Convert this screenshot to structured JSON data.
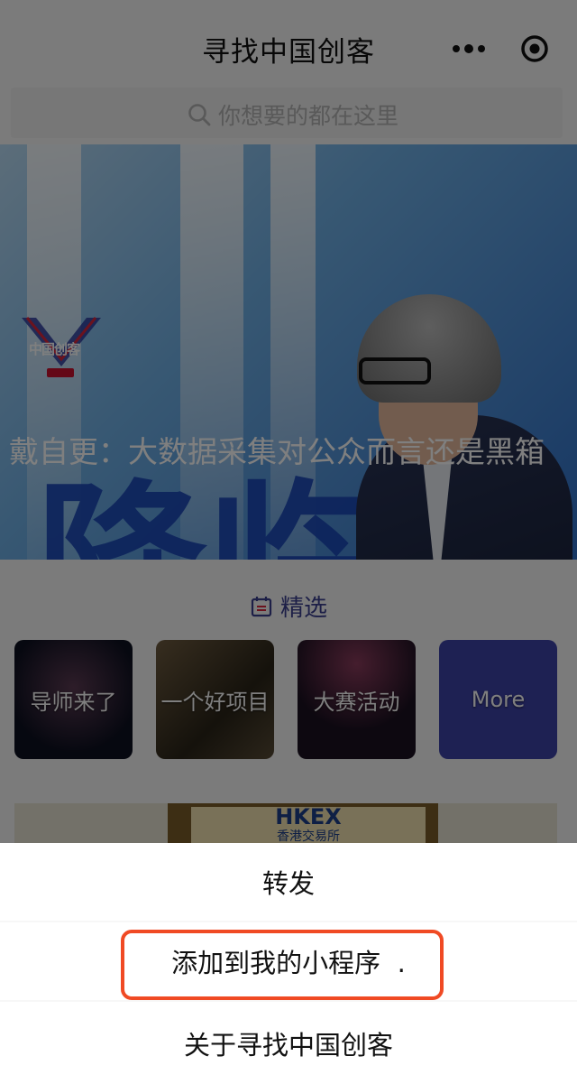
{
  "header": {
    "title": "寻找中国创客",
    "more_icon": "more-dots-icon",
    "close_icon": "target-close-icon"
  },
  "search": {
    "placeholder": "你想要的都在这里",
    "icon": "search-icon"
  },
  "banner": {
    "caption": "戴自更：大数据采集对公众而言还是黑箱",
    "background_text": "降临",
    "logo_text": "中国创客",
    "active_slide": 1,
    "slide_count": 3
  },
  "section": {
    "icon": "calendar-icon",
    "title": "精选"
  },
  "tiles": [
    {
      "label": "导师来了"
    },
    {
      "label": "一个好项目"
    },
    {
      "label": "大赛活动"
    },
    {
      "label": "More"
    }
  ],
  "news_card": {
    "logo": "HKEX",
    "subtitle": "香港交易所"
  },
  "action_sheet": {
    "items": [
      {
        "label": "转发"
      },
      {
        "label": "添加到我的小程序  ."
      },
      {
        "label": "关于寻找中国创客"
      }
    ],
    "highlighted_index": 1,
    "highlight_color": "#f04a24"
  },
  "colors": {
    "accent": "#3a3f8f",
    "more_tile": "#3d42a6",
    "overlay": "rgba(0,0,0,0.5)"
  }
}
